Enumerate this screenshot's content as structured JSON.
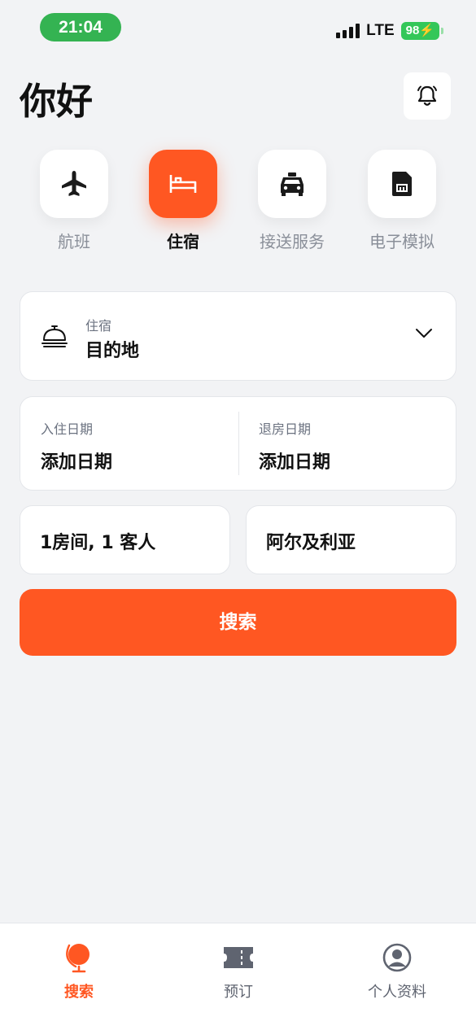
{
  "status_bar": {
    "time": "21:04",
    "network": "LTE",
    "battery": "98"
  },
  "header": {
    "greeting": "你好"
  },
  "categories": [
    {
      "label": "航班",
      "icon": "airplane-icon",
      "active": false
    },
    {
      "label": "住宿",
      "icon": "bed-icon",
      "active": true
    },
    {
      "label": "接送服务",
      "icon": "taxi-icon",
      "active": false
    },
    {
      "label": "电子模拟",
      "icon": "sim-card-icon",
      "active": false
    }
  ],
  "form": {
    "destination": {
      "label": "住宿",
      "value": "目的地"
    },
    "check_in": {
      "label": "入住日期",
      "value": "添加日期"
    },
    "check_out": {
      "label": "退房日期",
      "value": "添加日期"
    },
    "guests": "1房间, 1 客人",
    "country": "阿尔及利亚",
    "search_label": "搜索"
  },
  "bottom_nav": [
    {
      "label": "搜索",
      "icon": "globe-icon",
      "active": true
    },
    {
      "label": "预订",
      "icon": "ticket-icon",
      "active": false
    },
    {
      "label": "个人资料",
      "icon": "profile-icon",
      "active": false
    }
  ],
  "colors": {
    "accent": "#ff5722",
    "background": "#f2f3f5",
    "status_pill": "#34b352"
  }
}
